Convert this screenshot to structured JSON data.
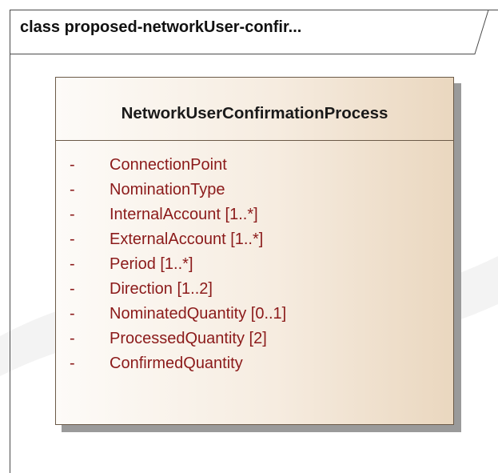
{
  "frame": {
    "title": "class proposed-networkUser-confir..."
  },
  "class": {
    "name": "NetworkUserConfirmationProcess",
    "attributes": [
      {
        "visibility": "-",
        "text": "ConnectionPoint"
      },
      {
        "visibility": "-",
        "text": "NominationType"
      },
      {
        "visibility": "-",
        "text": "InternalAccount [1..*]"
      },
      {
        "visibility": "-",
        "text": "ExternalAccount [1..*]"
      },
      {
        "visibility": "-",
        "text": "Period [1..*]"
      },
      {
        "visibility": "-",
        "text": "Direction [1..2]"
      },
      {
        "visibility": "-",
        "text": "NominatedQuantity [0..1]"
      },
      {
        "visibility": "-",
        "text": "ProcessedQuantity [2]"
      },
      {
        "visibility": "-",
        "text": "ConfirmedQuantity"
      }
    ]
  },
  "colors": {
    "attribute_text": "#8b1a1a",
    "class_fill_light": "#fdfbf8",
    "class_fill_dark": "#ead7bf",
    "border": "#6b5a48"
  }
}
